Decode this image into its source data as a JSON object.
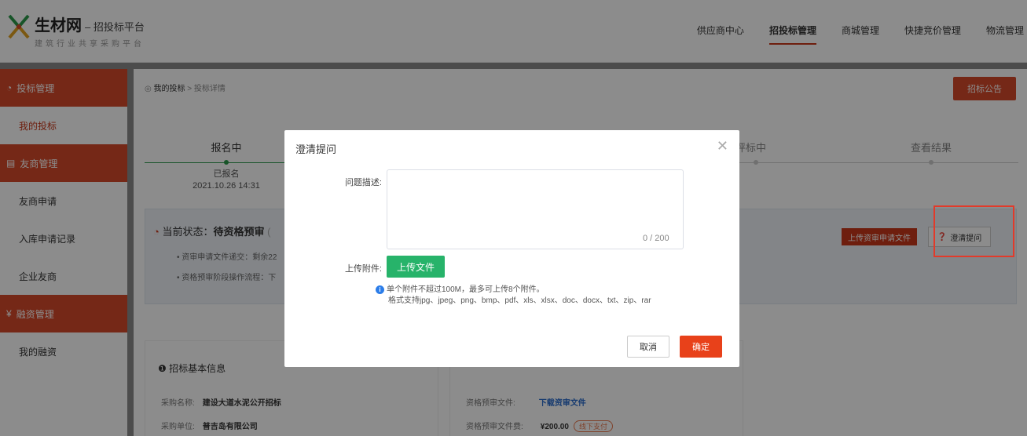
{
  "header": {
    "brand": "生材网",
    "brand_suffix": "– 招投标平台",
    "slogan": "建筑行业共享采购平台",
    "nav": [
      "供应商中心",
      "招投标管理",
      "商城管理",
      "快捷竞价管理",
      "物流管理"
    ],
    "nav_active_index": 1
  },
  "sidebar": {
    "groups": [
      {
        "label": "投标管理",
        "items": [
          "我的投标"
        ]
      },
      {
        "label": "友商管理",
        "items": [
          "友商申请",
          "入库申请记录",
          "企业友商"
        ]
      },
      {
        "label": "融资管理",
        "items": [
          "我的融资"
        ]
      }
    ]
  },
  "main": {
    "breadcrumb_prefix": "我的投标",
    "breadcrumb_sep": " > ",
    "breadcrumb_current": "投标详情",
    "notice_button": "招标公告",
    "steps": [
      {
        "title": "报名中",
        "sub": "已报名",
        "date": "2021.10.26 14:31"
      },
      {
        "title": "标、评标中"
      },
      {
        "title": "查看结果"
      }
    ],
    "status_label": "当前状态：",
    "status_value": "待资格预审",
    "status_hint": "(",
    "bullets": [
      "资审申请文件递交：剩余22",
      "资格预审阶段操作流程：下"
    ],
    "upload_app_button": "上传资审申请文件",
    "clarify_button": "澄清提问",
    "basic_info_title": "招标基本信息",
    "info_left": [
      {
        "label": "采购名称:",
        "value": "建设大道水泥公开招标"
      },
      {
        "label": "采购单位:",
        "value": "普吉岛有限公司"
      }
    ],
    "info_right": [
      {
        "label": "资格预审文件:",
        "value": "下载资审文件"
      },
      {
        "label": "资格预审文件费:",
        "value": "¥200.00",
        "tag": "线下支付"
      }
    ]
  },
  "modal": {
    "title": "澄清提问",
    "desc_label": "问题描述:",
    "counter": "0 / 200",
    "attach_label": "上传附件:",
    "upload_button": "上传文件",
    "hint_line1": "单个附件不超过100M，最多可上传8个附件。",
    "hint_line2": "格式支持jpg、jpeg、png、bmp、pdf、xls、xlsx、doc、docx、txt、zip、rar",
    "cancel": "取消",
    "ok": "确定"
  },
  "colors": {
    "brand_red": "#d54a2a",
    "confirm": "#e8411a",
    "upload_green": "#27b36a",
    "highlight": "#e23a2a"
  }
}
